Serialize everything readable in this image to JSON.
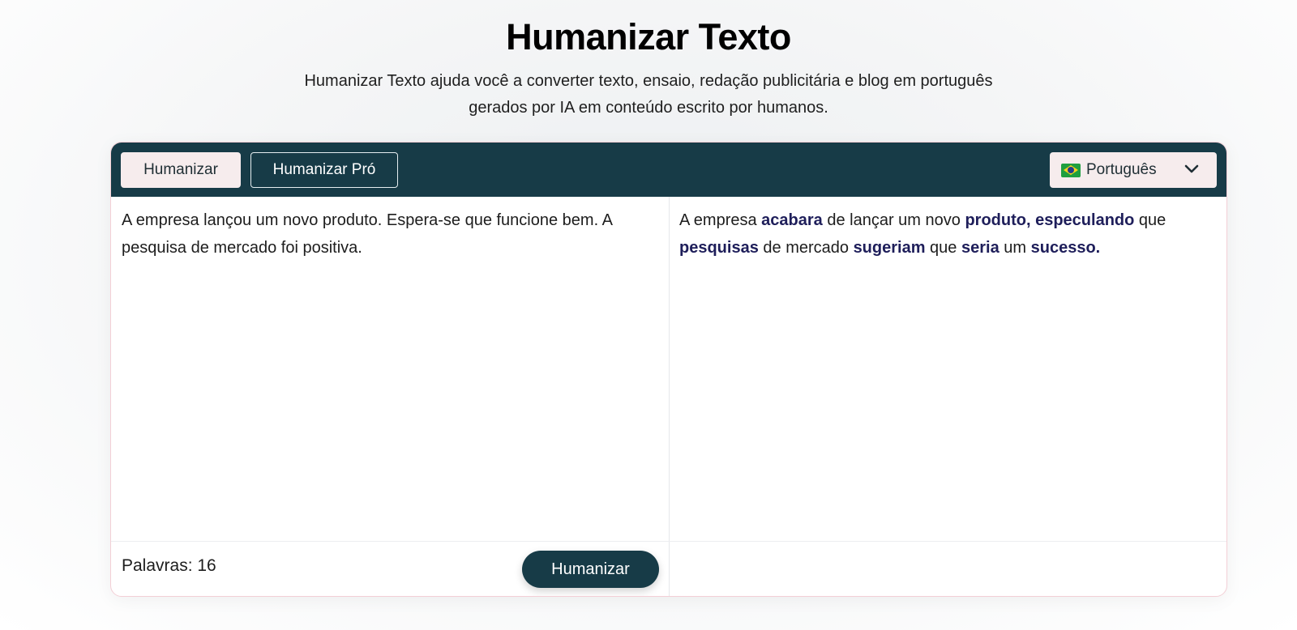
{
  "header": {
    "title": "Humanizar Texto",
    "subtitle": "Humanizar Texto ajuda você a converter texto, ensaio, redação publicitária e blog em português gerados por IA em conteúdo escrito por humanos."
  },
  "toolbar": {
    "mode_humanizar": "Humanizar",
    "mode_pro": "Humanizar Pró",
    "language": "Português",
    "language_flag_icon": "brazil-flag-icon",
    "dropdown_icon": "chevron-down-icon"
  },
  "input": {
    "text": "A empresa lançou um novo produto. Espera-se que funcione bem. A pesquisa de mercado foi positiva.",
    "word_count_label": "Palavras: 16",
    "humanize_button": "Humanizar"
  },
  "output": {
    "segments": [
      {
        "text": "A empresa ",
        "changed": false
      },
      {
        "text": "acabara",
        "changed": true
      },
      {
        "text": " de lançar um novo ",
        "changed": false
      },
      {
        "text": "produto, especulando",
        "changed": true
      },
      {
        "text": " que ",
        "changed": false
      },
      {
        "text": "pesquisas",
        "changed": true
      },
      {
        "text": " de mercado ",
        "changed": false
      },
      {
        "text": "sugeriam",
        "changed": true
      },
      {
        "text": " que ",
        "changed": false
      },
      {
        "text": "seria",
        "changed": true
      },
      {
        "text": " um ",
        "changed": false
      },
      {
        "text": "sucesso.",
        "changed": true
      }
    ]
  },
  "colors": {
    "primary": "#173b47",
    "highlight_text": "#1e1e5a",
    "button_light": "#f6eced",
    "card_border": "#f3cfd6"
  }
}
